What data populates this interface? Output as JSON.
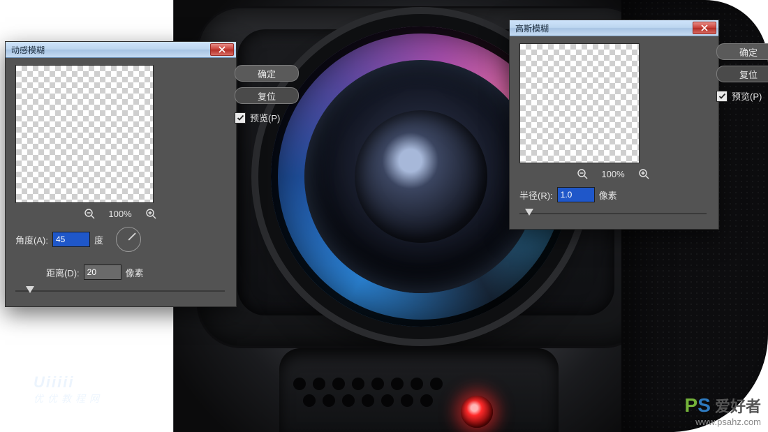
{
  "motion": {
    "title": "动感模糊",
    "ok_label": "确定",
    "reset_label": "复位",
    "preview_label": "预览(P)",
    "preview_checked": true,
    "zoom_pct": "100%",
    "angle_label": "角度(A):",
    "angle_value": "45",
    "angle_unit": "度",
    "distance_label": "距离(D):",
    "distance_value": "20",
    "distance_unit": "像素",
    "slider_pos_pct": 5
  },
  "gauss": {
    "title": "高斯模糊",
    "ok_label": "确定",
    "reset_label": "复位",
    "preview_label": "预览(P)",
    "preview_checked": true,
    "zoom_pct": "100%",
    "radius_label": "半径(R):",
    "radius_value": "1.0",
    "radius_unit": "像素",
    "slider_pos_pct": 3
  },
  "icons": {
    "close": "close-icon",
    "zoom_out": "zoom-out-icon",
    "zoom_in": "zoom-in-icon",
    "check": "check-icon"
  },
  "watermark": {
    "left_logo": "Uiiiii",
    "left_sub": "优优教程网",
    "right_brand_p": "P",
    "right_brand_s": "S",
    "right_brand_cn": " 爱好者",
    "right_url": "www.psahz.com"
  }
}
